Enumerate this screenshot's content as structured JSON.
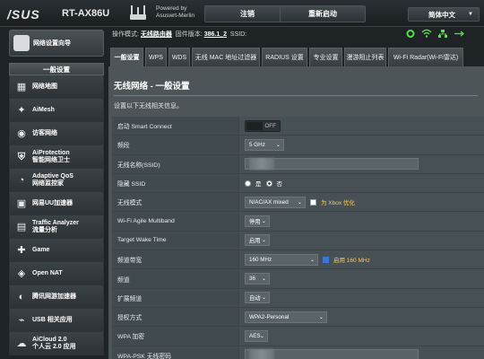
{
  "header": {
    "logo": "/SUS",
    "model": "RT-AX86U",
    "powered_by_line1": "Powered by",
    "powered_by_line2": "Asuswrt-Merlin",
    "logout_label": "注销",
    "reboot_label": "重新启动",
    "language_label": "简体中文"
  },
  "status": {
    "mode_label": "操作模式:",
    "mode_value": "无线路由器",
    "firmware_label": "固件版本:",
    "firmware_value": "386.1_2",
    "ssid_label": "SSID:"
  },
  "sidebar": {
    "qis_label": "网络设置向导",
    "section_title": "一般设置",
    "items": [
      {
        "label": "网络地图",
        "icon": "network-map-icon"
      },
      {
        "label": "AiMesh",
        "icon": "aimesh-icon"
      },
      {
        "label": "访客网络",
        "icon": "guest-network-icon"
      },
      {
        "label": "AiProtection",
        "sub": "智能网络卫士",
        "icon": "shield-icon"
      },
      {
        "label": "Adaptive QoS",
        "sub": "网络监控家",
        "icon": "qos-icon"
      },
      {
        "label": "网易UU加速器",
        "icon": "uu-booster-icon"
      },
      {
        "label": "Traffic Analyzer",
        "sub": "流量分析",
        "icon": "traffic-analyzer-icon"
      },
      {
        "label": "Game",
        "icon": "game-icon"
      },
      {
        "label": "Open NAT",
        "icon": "open-nat-icon"
      },
      {
        "label": "腾讯网游加速器",
        "icon": "game-booster-icon"
      },
      {
        "label": "USB 相关应用",
        "icon": "usb-icon"
      },
      {
        "label": "AiCloud 2.0",
        "sub": "个人云 2.0 应用",
        "icon": "aicloud-icon"
      }
    ]
  },
  "tabs": [
    {
      "label": "一般设置",
      "active": true
    },
    {
      "label": "WPS"
    },
    {
      "label": "WDS"
    },
    {
      "label": "无线 MAC 地址过滤器"
    },
    {
      "label": "RADIUS 设置"
    },
    {
      "label": "专业设置"
    },
    {
      "label": "漫游阻止列表"
    },
    {
      "label": "Wi-Fi Radar(Wi-Fi雷达)"
    }
  ],
  "panel": {
    "title": "无线网络 - 一般设置",
    "description": "设置以下无线相关信息。"
  },
  "form": {
    "smart_connect": {
      "label": "启动 Smart Connect",
      "value": "OFF"
    },
    "band": {
      "label": "频段",
      "value": "5 GHz"
    },
    "ssid": {
      "label": "无线名称(SSID)",
      "value": ""
    },
    "hide_ssid": {
      "label": "隐藏 SSID",
      "opt_yes": "是",
      "opt_no": "否",
      "selected": "否"
    },
    "wireless_mode": {
      "label": "无线模式",
      "value": "N/AC/AX mixed",
      "check_label": "为 Xbox 优化"
    },
    "multiband": {
      "label": "Wi-Fi Agile Multiband",
      "value": "停用"
    },
    "twt": {
      "label": "Target Wake Time",
      "value": "启用"
    },
    "bandwidth": {
      "label": "频道带宽",
      "value": "160 MHz",
      "check_label": "启用 160 MHz"
    },
    "channel": {
      "label": "频道",
      "value": "36"
    },
    "ext_channel": {
      "label": "扩展频道",
      "value": "自动"
    },
    "auth": {
      "label": "授权方式",
      "value": "WPA2-Personal"
    },
    "wpa_enc": {
      "label": "WPA 加密",
      "value": "AES"
    },
    "wpa_psk": {
      "label": "WPA-PSK 无线密码",
      "value": ""
    }
  }
}
